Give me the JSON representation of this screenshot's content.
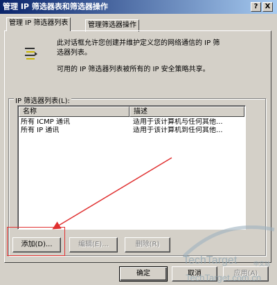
{
  "window": {
    "title": "管理 IP 筛选器表和筛选器操作",
    "help_button": "?",
    "close_button": "X"
  },
  "tabs": [
    {
      "label": "管理 IP 筛选器列表",
      "active": true
    },
    {
      "label": "管理筛选器操作",
      "active": false
    }
  ],
  "description": {
    "line1": "此对话框允许您创建并维护定义您的网络通信的 IP 筛",
    "line2": "选器列表。",
    "line3": "可用的 IP 筛选器列表被所有的 IP 安全策略共享。",
    "icon": "filter-list-icon"
  },
  "filter_list": {
    "group_label": "IP 筛选器列表(L):",
    "columns": [
      "名称",
      "描述"
    ],
    "rows": [
      {
        "name": "所有 ICMP 通讯",
        "description": "适用于该计算机与任何其他..."
      },
      {
        "name": "所有 IP 通讯",
        "description": "适用于该计算机到任何其他..."
      }
    ]
  },
  "buttons": {
    "add": "添加(D)...",
    "edit": "编辑(E)...",
    "remove": "删除(R)",
    "ok": "确定",
    "cancel": "取消",
    "apply": "应用(A)"
  },
  "watermark": {
    "brand": "TechTarget",
    "brand_cn": "中文站",
    "url": "TechTarget.com.cn"
  },
  "colors": {
    "dialog_bg": "#d4d0c8",
    "title_start": "#0a246a",
    "title_end": "#a6caf0",
    "annotation_red": "#e03030"
  }
}
